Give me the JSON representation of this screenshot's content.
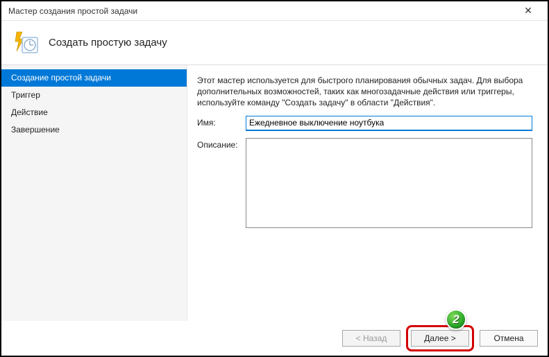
{
  "window": {
    "title": "Мастер создания простой задачи"
  },
  "header": {
    "subtitle": "Создать простую задачу"
  },
  "sidebar": {
    "items": [
      {
        "label": "Создание простой задачи",
        "active": true
      },
      {
        "label": "Триггер",
        "active": false
      },
      {
        "label": "Действие",
        "active": false
      },
      {
        "label": "Завершение",
        "active": false
      }
    ]
  },
  "content": {
    "intro": "Этот мастер используется для быстрого планирования обычных задач.  Для выбора дополнительных возможностей, таких как многозадачные действия или триггеры, используйте команду \"Создать задачу\" в области \"Действия\".",
    "name_label": "Имя:",
    "name_value": "Ежедневное выключение ноутбука",
    "desc_label": "Описание:",
    "desc_value": ""
  },
  "footer": {
    "back": "< Назад",
    "next": "Далее >",
    "cancel": "Отмена"
  },
  "annotation": {
    "badge": "2"
  }
}
